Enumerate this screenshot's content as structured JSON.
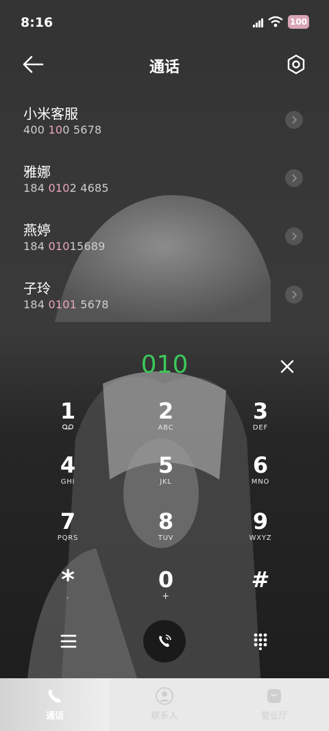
{
  "status_bar": {
    "time": "8:16",
    "battery": "100"
  },
  "header": {
    "title": "通话"
  },
  "contacts": [
    {
      "name": "小米客服",
      "number_pre": "400 ",
      "number_hl": "10",
      "number_post": "0 5678"
    },
    {
      "name": "雅娜",
      "number_pre": "184 ",
      "number_hl": "010",
      "number_post": "2 4685"
    },
    {
      "name": "燕婷",
      "number_pre": "184 ",
      "number_hl": "010",
      "number_post": "15689"
    },
    {
      "name": "子玲",
      "number_pre": "184 ",
      "number_hl": "0101",
      "number_post": " 5678"
    }
  ],
  "dialer": {
    "entered": "010",
    "accent_color": "#3cc85a",
    "keys": [
      {
        "digit": "1",
        "letters": ""
      },
      {
        "digit": "2",
        "letters": "ABC"
      },
      {
        "digit": "3",
        "letters": "DEF"
      },
      {
        "digit": "4",
        "letters": "GHI"
      },
      {
        "digit": "5",
        "letters": "JKL"
      },
      {
        "digit": "6",
        "letters": "MNO"
      },
      {
        "digit": "7",
        "letters": "PQRS"
      },
      {
        "digit": "8",
        "letters": "TUV"
      },
      {
        "digit": "9",
        "letters": "WXYZ"
      },
      {
        "digit": "*",
        "letters": ","
      },
      {
        "digit": "0",
        "letters": "+"
      },
      {
        "digit": "#",
        "letters": ""
      }
    ]
  },
  "nav": {
    "tabs": [
      {
        "label": "通话",
        "icon": "phone-icon",
        "active": true
      },
      {
        "label": "联系人",
        "icon": "person-icon",
        "active": false
      },
      {
        "label": "营业厅",
        "icon": "shop-bag-icon",
        "active": false
      }
    ]
  }
}
